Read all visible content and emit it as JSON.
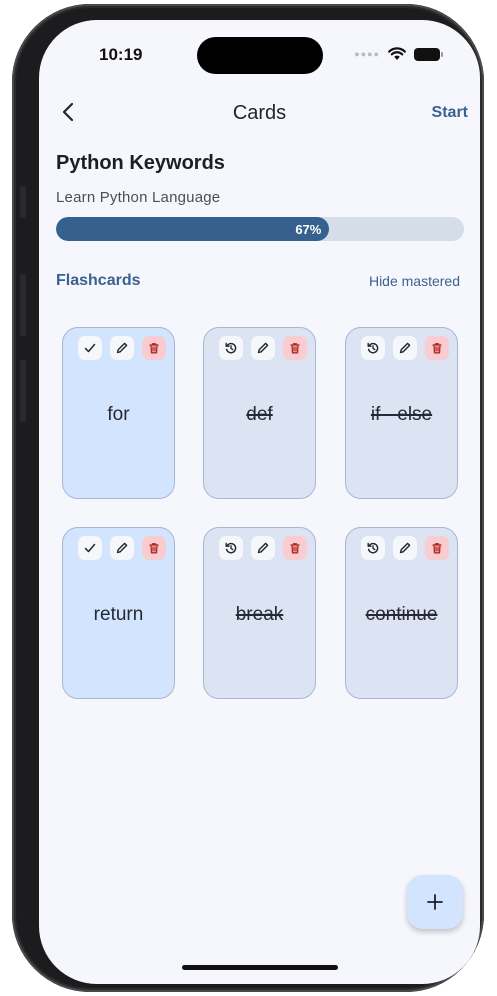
{
  "status_bar": {
    "time": "10:19"
  },
  "nav": {
    "title": "Cards",
    "start_label": "Start"
  },
  "deck": {
    "title": "Python Keywords",
    "subtitle": "Learn Python Language",
    "progress_percent": 67,
    "progress_label": "67%"
  },
  "section": {
    "title": "Flashcards",
    "toggle_label": "Hide mastered"
  },
  "cards": [
    {
      "word": "for",
      "mastered": false
    },
    {
      "word": "def",
      "mastered": true
    },
    {
      "word": "if - else",
      "mastered": true
    },
    {
      "word": "return",
      "mastered": false
    },
    {
      "word": "break",
      "mastered": true
    },
    {
      "word": "continue",
      "mastered": true
    }
  ],
  "icons": {
    "status": [
      "signal-dots-icon",
      "wifi-icon",
      "battery-icon"
    ],
    "nav": "chevron-left-icon",
    "card_actions_active": [
      "check-icon",
      "pencil-icon",
      "trash-icon"
    ],
    "card_actions_mastered": [
      "undo-icon",
      "pencil-icon",
      "trash-icon"
    ],
    "fab": "plus-icon"
  },
  "colors": {
    "accent": "#36618f",
    "card_active": "#d2e4fe",
    "card_mastered": "#dce4f4",
    "danger_bg": "#f8ccd0",
    "trash": "#b3261e"
  }
}
